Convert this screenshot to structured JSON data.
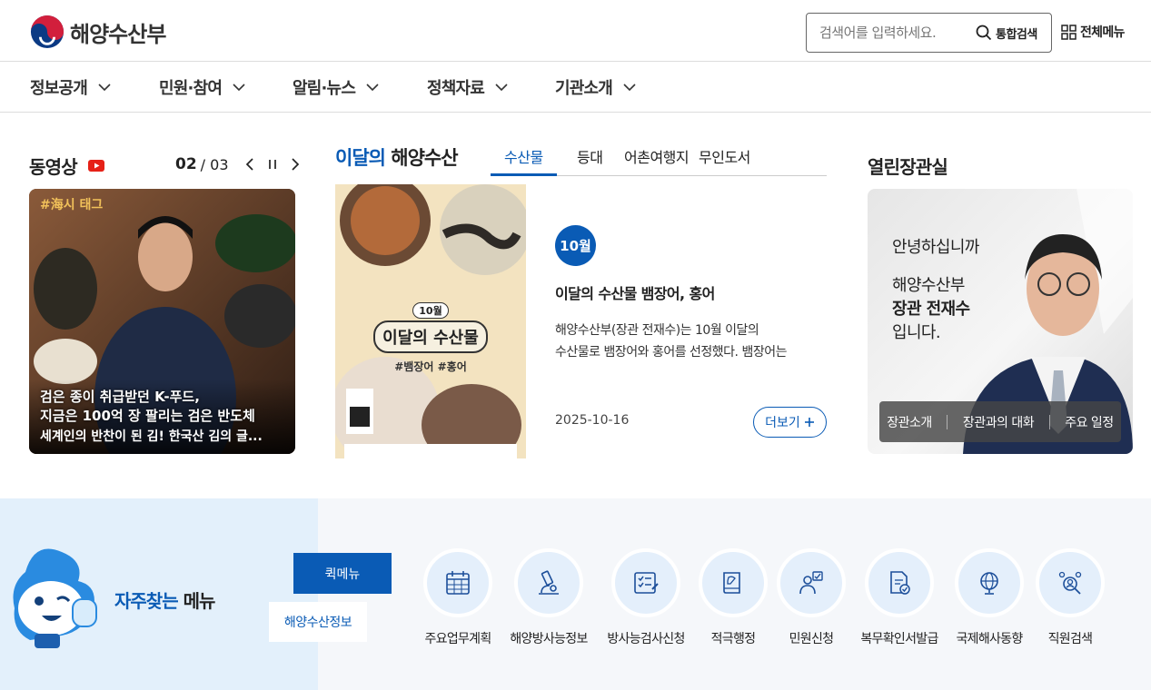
{
  "header": {
    "logo_text": "해양수산부",
    "search_placeholder": "검색어를 입력하세요.",
    "search_button": "통합검색",
    "all_menu": "전체메뉴"
  },
  "gnb": [
    "정보공개",
    "민원·참여",
    "알림·뉴스",
    "정책자료",
    "기관소개"
  ],
  "video": {
    "title": "동영상",
    "current": "02",
    "total": "/ 03",
    "overlay_line1": "검은 종이 취급받던 K-푸드,",
    "overlay_line2": "지금은 100억 장 팔리는 검은 반도체",
    "caption": "세계인의 반찬이 된 김! 한국산 김의 글...",
    "tag": "#海시 태그"
  },
  "month": {
    "title_highlight": "이달의",
    "title_rest": "해양수산",
    "tabs": [
      "수산물",
      "등대",
      "어촌여행지",
      "무인도서"
    ],
    "active_tab": 0,
    "badge": "10월",
    "headline": "이달의 수산물 뱀장어, 홍어",
    "desc_line1": "해양수산부(장관 전재수)는 10월 이달의",
    "desc_line2": "수산물로 뱀장어와 홍어를 선정했다. 뱀장어는",
    "date": "2025-10-16",
    "more": "더보기",
    "poster": {
      "month_tag": "10월",
      "title": "이달의 수산물",
      "tags": "#뱀장어  #홍어"
    }
  },
  "minister": {
    "title": "열린장관실",
    "greet1": "안녕하십니까",
    "greet2": "해양수산부",
    "greet3": "장관 전재수",
    "greet4": "입니다.",
    "links": [
      "장관소개",
      "장관과의 대화",
      "주요 일정"
    ]
  },
  "quick": {
    "title_highlight": "자주찾는",
    "title_rest": "메뉴",
    "tab_active": "퀵메뉴",
    "tab_other": "해양수산정보",
    "items": [
      {
        "label": "주요업무계획",
        "icon": "calendar-icon"
      },
      {
        "label": "해양방사능정보",
        "icon": "microscope-icon"
      },
      {
        "label": "방사능검사신청",
        "icon": "checklist-icon"
      },
      {
        "label": "적극행정",
        "icon": "book-icon"
      },
      {
        "label": "민원신청",
        "icon": "person-check-icon"
      },
      {
        "label": "복무확인서발급",
        "icon": "document-check-icon"
      },
      {
        "label": "국제해사동향",
        "icon": "globe-icon"
      },
      {
        "label": "직원검색",
        "icon": "people-search-icon"
      }
    ]
  },
  "colors": {
    "accent": "#0a5bb5",
    "youtube": "#e62117"
  }
}
